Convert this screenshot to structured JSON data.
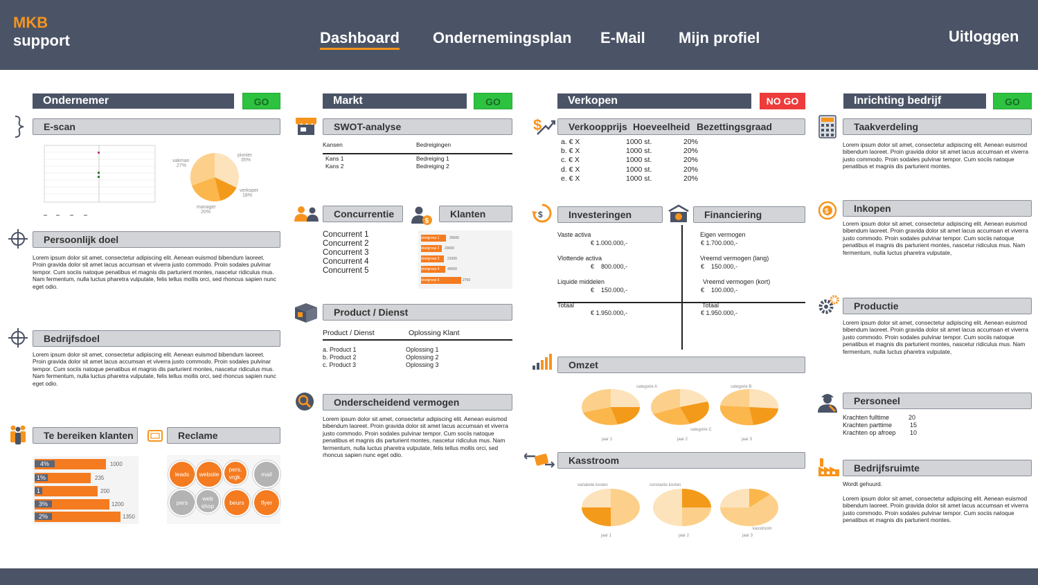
{
  "logo": {
    "line1": "MKB",
    "line2": "support"
  },
  "nav": {
    "dashboard": "Dashboard",
    "plan": "Ondernemingsplan",
    "email": "E-Mail",
    "profile": "Mijn profiel",
    "logout": "Uitloggen"
  },
  "colors": {
    "header": "#4b5466",
    "accent": "#f7941d",
    "go": "#2dc240",
    "nogo": "#ee3b3b"
  },
  "lorem_short": "Lorem ipsum dolor sit amet, consectetur adipiscing elit. Aenean euismod bibendum laoreet. Proin gravida dolor sit amet lacus accumsan et viverra justo commodo. Proin sodales pulvinar tempor. Cum sociis natoque penatibus et magnis dis parturient montes.",
  "lorem_long": "Lorem ipsum dolor sit amet, consectetur adipiscing elit. Aenean euismod bibendum laoreet. Proin gravida dolor sit amet lacus accumsan et viverra justo commodo. Proin sodales pulvinar tempor. Cum sociis natoque penatibus et magnis dis parturient montes, nascetur ridiculus mus. Nam fermentum, nulla luctus pharetra vulputate,",
  "lorem_col1": "Lorem ipsum dolor sit amet, consectetur adipiscing elit. Aenean euismod bibendum laoreet. Proin gravida dolor sit amet lacus accumsan et viverra justo commodo. Proin sodales pulvinar tempor. Cum sociis natoque penatibus et magnis dis parturient montes, nascetur ridiculus mus. Nam fermentum, nulla luctus pharetra vulputate, felis tellus mollis orci, sed rhoncus sapien nunc eget odio.",
  "col1": {
    "title": "Ondernemer",
    "status": "GO",
    "escan": "E-scan",
    "escan_pie": {
      "labels": [
        "pionier",
        "vakman",
        "verkoper",
        "manager"
      ],
      "values": [
        "35%",
        "27%",
        "18%",
        "20%"
      ]
    },
    "doel": "Persoonlijk doel",
    "bedrijfsdoel": "Bedrijfsdoel",
    "klanten": "Te bereiken klanten",
    "klanten_bars": [
      {
        "pct": "4%",
        "value": "1000"
      },
      {
        "pct": "1%",
        "value": "235"
      },
      {
        "pct": "1",
        "value": "200"
      },
      {
        "pct": "3%",
        "value": "1200"
      },
      {
        "pct": "2%",
        "value": "1350"
      }
    ],
    "reclame": "Reclame",
    "reclame_items": [
      "leads",
      "website",
      "pers. vrgk.",
      "mail",
      "pers",
      "web shop",
      "beurs",
      "flyer"
    ]
  },
  "col2": {
    "title": "Markt",
    "status": "GO",
    "swot": "SWOT-analyse",
    "kansen_h": "Kansen",
    "bedreigingen_h": "Bedreigingen",
    "kansen": [
      "Kans 1",
      "Kans 2"
    ],
    "bedreigingen": [
      "Bedreiging 1",
      "Bedreiging 2"
    ],
    "concurrentie": "Concurrentie",
    "concurrenten": [
      "Concurrent 1",
      "Concurrent 2",
      "Concurrent 3",
      "Concurrent 4",
      "Concurrent 5"
    ],
    "klanten": "Klanten",
    "klanten_bars": [
      {
        "label": "doelgroep 1",
        "value": "25000"
      },
      {
        "label": "doelgroep 2",
        "value": "20000"
      },
      {
        "label": "doelgroep 3",
        "value": "21000"
      },
      {
        "label": "doelgroep 4",
        "value": "40000"
      },
      {
        "label": "doelgroep 5",
        "value": "2750"
      }
    ],
    "product": "Product / Dienst",
    "product_h": "Product / Dienst",
    "oplossing_h": "Oplossing Klant",
    "products": [
      "a. Product 1",
      "b. Product 2",
      "c. Product 3"
    ],
    "oplossingen": [
      "Oplossing 1",
      "Oplossing 2",
      "Oplossing 3"
    ],
    "onderscheidend": "Onderscheidend vermogen"
  },
  "col3": {
    "title": "Verkopen",
    "status": "NO GO",
    "h_prijs": "Verkoopprijs",
    "h_hoeveelheid": "Hoeveelheid",
    "h_bezetting": "Bezettingsgraad",
    "rows": [
      {
        "prijs": "a.  € X",
        "hoeveel": "1000 st.",
        "bez": "20%"
      },
      {
        "prijs": "b.  € X",
        "hoeveel": "1000 st.",
        "bez": "20%"
      },
      {
        "prijs": "c.  € X",
        "hoeveel": "1000 st.",
        "bez": "20%"
      },
      {
        "prijs": "d.  € X",
        "hoeveel": "1000 st.",
        "bez": "20%"
      },
      {
        "prijs": "e.  € X",
        "hoeveel": "1000 st.",
        "bez": "20%"
      }
    ],
    "investeringen": "Investeringen",
    "financiering": "Financiering",
    "vaste": "Vaste activa",
    "vaste_v": "€ 1.000.000,-",
    "vlottende": "Vlottende activa",
    "vlottende_v": "€    800.000,-",
    "liquide": "Liquide middelen",
    "liquide_v": "€    150.000,-",
    "totaal_l": "Totaal",
    "totaal_l_v": "€ 1.950.000,-",
    "eigen": "Eigen vermogen",
    "eigen_v": "€ 1.700.000,-",
    "vreemd_lang": "Vreemd vermogen (lang)",
    "vreemd_lang_v": "€    150.000,-",
    "vreemd_kort": "Vreemd vermogen (kort)",
    "vreemd_kort_v": "€    100.000,-",
    "totaal_r": "Totaal",
    "totaal_r_v": "€ 1.950.000,-",
    "omzet": "Omzet",
    "omzet_years": [
      "jaar 1",
      "jaar 2",
      "jaar 3"
    ],
    "omzet_cats": [
      "categorie A",
      "categorie B",
      "categorie C"
    ],
    "kasstroom": "Kasstroom",
    "kas_labels": [
      "variabele kosten",
      "constante kosten",
      "kasstroom"
    ]
  },
  "col4": {
    "title": "Inrichting bedrijf",
    "status": "GO",
    "taak": "Taakverdeling",
    "inkopen": "Inkopen",
    "productie": "Productie",
    "personeel": "Personeel",
    "personeel_rows": [
      {
        "label": "Krachten fulltime",
        "value": "20"
      },
      {
        "label": "Krachten parttime",
        "value": "15"
      },
      {
        "label": "Krachten op afroep",
        "value": "10"
      }
    ],
    "bedrijfsruimte": "Bedrijfsruimte",
    "gehuurd": "Wordt gehuurd."
  }
}
